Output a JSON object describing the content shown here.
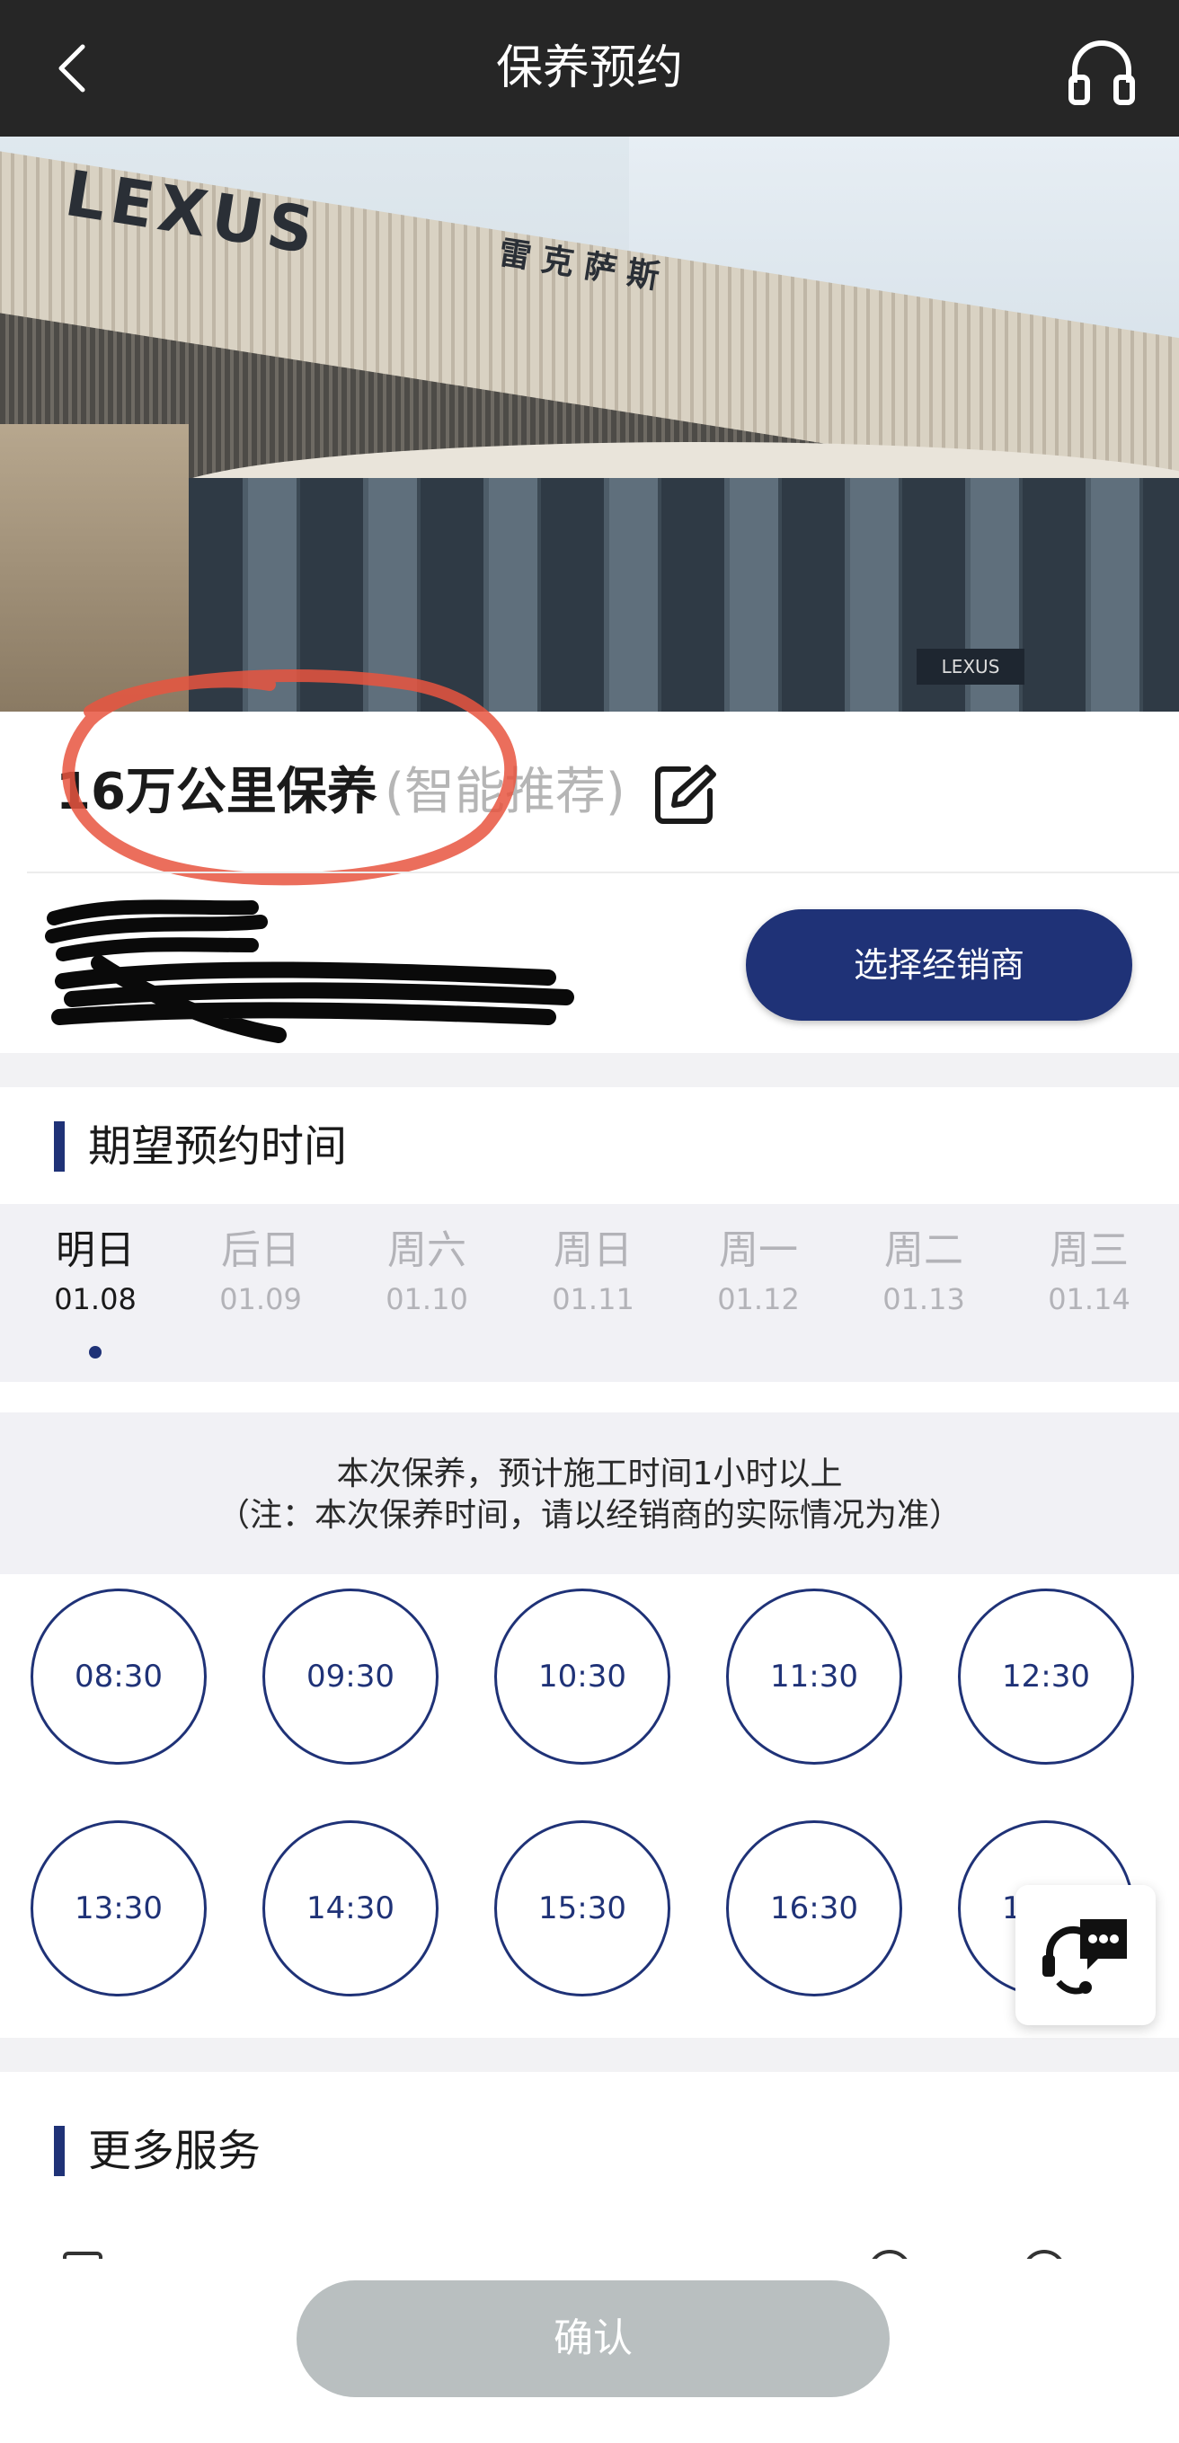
{
  "header": {
    "title": "保养预约",
    "back_icon": "back-arrow-icon",
    "support_icon": "headset-icon"
  },
  "hero": {
    "brand": "LEXUS",
    "brand_cn": "雷克萨斯",
    "sign": "LEXUS"
  },
  "package": {
    "name": "16万公里保养",
    "tag": "(智能推荐)",
    "edit_icon": "edit-icon"
  },
  "dealer": {
    "name": "",
    "address": "",
    "button_label": "选择经销商"
  },
  "appointment": {
    "title": "期望预约时间",
    "dates": [
      {
        "weekday": "明日",
        "date": "01.08",
        "active": true
      },
      {
        "weekday": "后日",
        "date": "01.09",
        "active": false
      },
      {
        "weekday": "周六",
        "date": "01.10",
        "active": false
      },
      {
        "weekday": "周日",
        "date": "01.11",
        "active": false
      },
      {
        "weekday": "周一",
        "date": "01.12",
        "active": false
      },
      {
        "weekday": "周二",
        "date": "01.13",
        "active": false
      },
      {
        "weekday": "周三",
        "date": "01.14",
        "active": false
      }
    ],
    "notice_line1": "本次保养，预计施工时间1小时以上",
    "notice_line2": "（注：本次保养时间，请以经销商的实际情况为准）",
    "slots": [
      "08:30",
      "09:30",
      "10:30",
      "11:30",
      "12:30",
      "13:30",
      "14:30",
      "15:30",
      "16:30",
      "17:30"
    ]
  },
  "more_services": {
    "title": "更多服务"
  },
  "footer": {
    "confirm_label": "确认"
  },
  "colors": {
    "accent": "#1f3277",
    "topbar": "#262626",
    "disabled": "#b9bfc0",
    "annotation": "#e8553f"
  }
}
